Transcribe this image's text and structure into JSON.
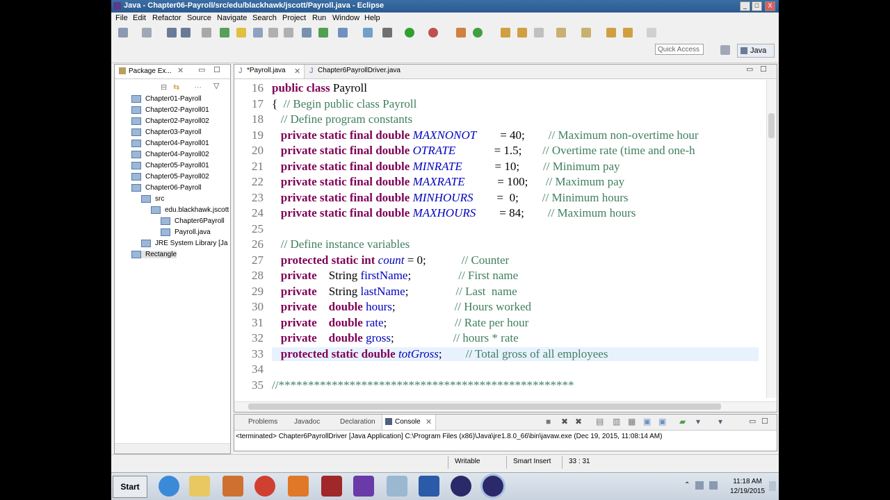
{
  "window": {
    "title": "Java - Chapter06-Payroll/src/edu/blackhawk/jscott/Payroll.java - Eclipse",
    "min": "_",
    "max": "□",
    "close": "X"
  },
  "menu": [
    "File",
    "Edit",
    "Refactor",
    "Source",
    "Navigate",
    "Search",
    "Project",
    "Run",
    "Window",
    "Help"
  ],
  "toolbar": {
    "quick_access": "Quick Access",
    "perspective": "Java"
  },
  "package_explorer": {
    "tab": "Package Ex...",
    "items": [
      {
        "label": "Chapter01-Payroll",
        "depth": 0
      },
      {
        "label": "Chapter02-Payroll01",
        "depth": 0
      },
      {
        "label": "Chapter02-Payroll02",
        "depth": 0
      },
      {
        "label": "Chapter03-Payroll",
        "depth": 0
      },
      {
        "label": "Chapter04-Payroll01",
        "depth": 0
      },
      {
        "label": "Chapter04-Payroll02",
        "depth": 0
      },
      {
        "label": "Chapter05-Payroll01",
        "depth": 0
      },
      {
        "label": "Chapter05-Payroll02",
        "depth": 0
      },
      {
        "label": "Chapter06-Payroll",
        "depth": 0
      },
      {
        "label": "src",
        "depth": 1
      },
      {
        "label": "edu.blackhawk.jscott",
        "depth": 2
      },
      {
        "label": "Chapter6Payroll",
        "depth": 3
      },
      {
        "label": "Payroll.java",
        "depth": 3
      },
      {
        "label": "JRE System Library [Ja",
        "depth": 1
      },
      {
        "label": "Rectangle",
        "depth": 0
      }
    ]
  },
  "editor": {
    "tabs": [
      "*Payroll.java",
      "Chapter6PayrollDriver.java"
    ],
    "lines": [
      {
        "n": "16",
        "parts": [
          [
            "kw",
            "public class "
          ],
          [
            "dk",
            "Payroll"
          ]
        ]
      },
      {
        "n": "17",
        "parts": [
          [
            "dk",
            "{  "
          ],
          [
            "cm",
            "// Begin public class Payroll"
          ]
        ]
      },
      {
        "n": "18",
        "parts": [
          [
            "cm",
            "   // Define program constants"
          ]
        ]
      },
      {
        "n": "19",
        "parts": [
          [
            "kw",
            "   private static final double "
          ],
          [
            "st",
            "MAXNONOT"
          ],
          [
            "dk",
            "        = 40;        "
          ],
          [
            "cm",
            "// Maximum non-overtime hour"
          ]
        ]
      },
      {
        "n": "20",
        "parts": [
          [
            "kw",
            "   private static final double "
          ],
          [
            "st",
            "OTRATE"
          ],
          [
            "dk",
            "             = 1.5;       "
          ],
          [
            "cm",
            "// Overtime rate (time and one-h"
          ]
        ]
      },
      {
        "n": "21",
        "parts": [
          [
            "kw",
            "   private static final double "
          ],
          [
            "st",
            "MINRATE"
          ],
          [
            "dk",
            "           = 10;        "
          ],
          [
            "cm",
            "// Minimum pay"
          ]
        ]
      },
      {
        "n": "22",
        "parts": [
          [
            "kw",
            "   private static final double "
          ],
          [
            "st",
            "MAXRATE"
          ],
          [
            "dk",
            "           = 100;      "
          ],
          [
            "cm",
            "// Maximum pay"
          ]
        ]
      },
      {
        "n": "23",
        "parts": [
          [
            "kw",
            "   private static final double "
          ],
          [
            "st",
            "MINHOURS"
          ],
          [
            "dk",
            "        =  0;        "
          ],
          [
            "cm",
            "// Minimum hours"
          ]
        ]
      },
      {
        "n": "24",
        "parts": [
          [
            "kw",
            "   private static final double "
          ],
          [
            "st",
            "MAXHOURS"
          ],
          [
            "dk",
            "        = 84;        "
          ],
          [
            "cm",
            "// Maximum hours"
          ]
        ]
      },
      {
        "n": "25",
        "parts": []
      },
      {
        "n": "26",
        "parts": [
          [
            "cm",
            "   // Define instance variables"
          ]
        ]
      },
      {
        "n": "27",
        "parts": [
          [
            "kw",
            "   protected static int "
          ],
          [
            "st",
            "count"
          ],
          [
            "dk",
            " = 0;            "
          ],
          [
            "cm",
            "// Counter"
          ]
        ]
      },
      {
        "n": "28",
        "parts": [
          [
            "kw",
            "   private    "
          ],
          [
            "dk",
            "String "
          ],
          [
            "fi",
            "firstName"
          ],
          [
            "dk",
            ";                "
          ],
          [
            "cm",
            "// First name"
          ]
        ]
      },
      {
        "n": "29",
        "parts": [
          [
            "kw",
            "   private    "
          ],
          [
            "dk",
            "String "
          ],
          [
            "fi",
            "lastName"
          ],
          [
            "dk",
            ";                "
          ],
          [
            "cm",
            "// Last  name"
          ]
        ]
      },
      {
        "n": "30",
        "parts": [
          [
            "kw",
            "   private    double "
          ],
          [
            "fi",
            "hours"
          ],
          [
            "dk",
            ";                    "
          ],
          [
            "cm",
            "// Hours worked"
          ]
        ]
      },
      {
        "n": "31",
        "parts": [
          [
            "kw",
            "   private    double "
          ],
          [
            "fi",
            "rate"
          ],
          [
            "dk",
            ";                       "
          ],
          [
            "cm",
            "// Rate per hour"
          ]
        ]
      },
      {
        "n": "32",
        "parts": [
          [
            "kw",
            "   private    double "
          ],
          [
            "fi",
            "gross"
          ],
          [
            "dk",
            ";                    "
          ],
          [
            "cm",
            "// hours * rate"
          ]
        ]
      },
      {
        "n": "33",
        "parts": [
          [
            "kw",
            "   protected static double "
          ],
          [
            "st",
            "totGross"
          ],
          [
            "dk",
            ";        "
          ],
          [
            "cm",
            "// Total gross of all employees"
          ]
        ]
      },
      {
        "n": "34",
        "parts": []
      },
      {
        "n": "35",
        "parts": [
          [
            "cm",
            "//**************************************************"
          ]
        ]
      }
    ]
  },
  "console": {
    "tabs": [
      "Problems",
      "Javadoc",
      "Declaration",
      "Console"
    ],
    "output": "<terminated> Chapter6PayrollDriver [Java Application] C:\\Program Files (x86)\\Java\\jre1.8.0_66\\bin\\javaw.exe (Dec 19, 2015, 11:08:14 AM)"
  },
  "status": {
    "mode": "Writable",
    "insert": "Smart Insert",
    "position": "33 : 31"
  },
  "taskbar": {
    "start": "Start",
    "time": "11:18 AM",
    "date": "12/19/2015"
  }
}
